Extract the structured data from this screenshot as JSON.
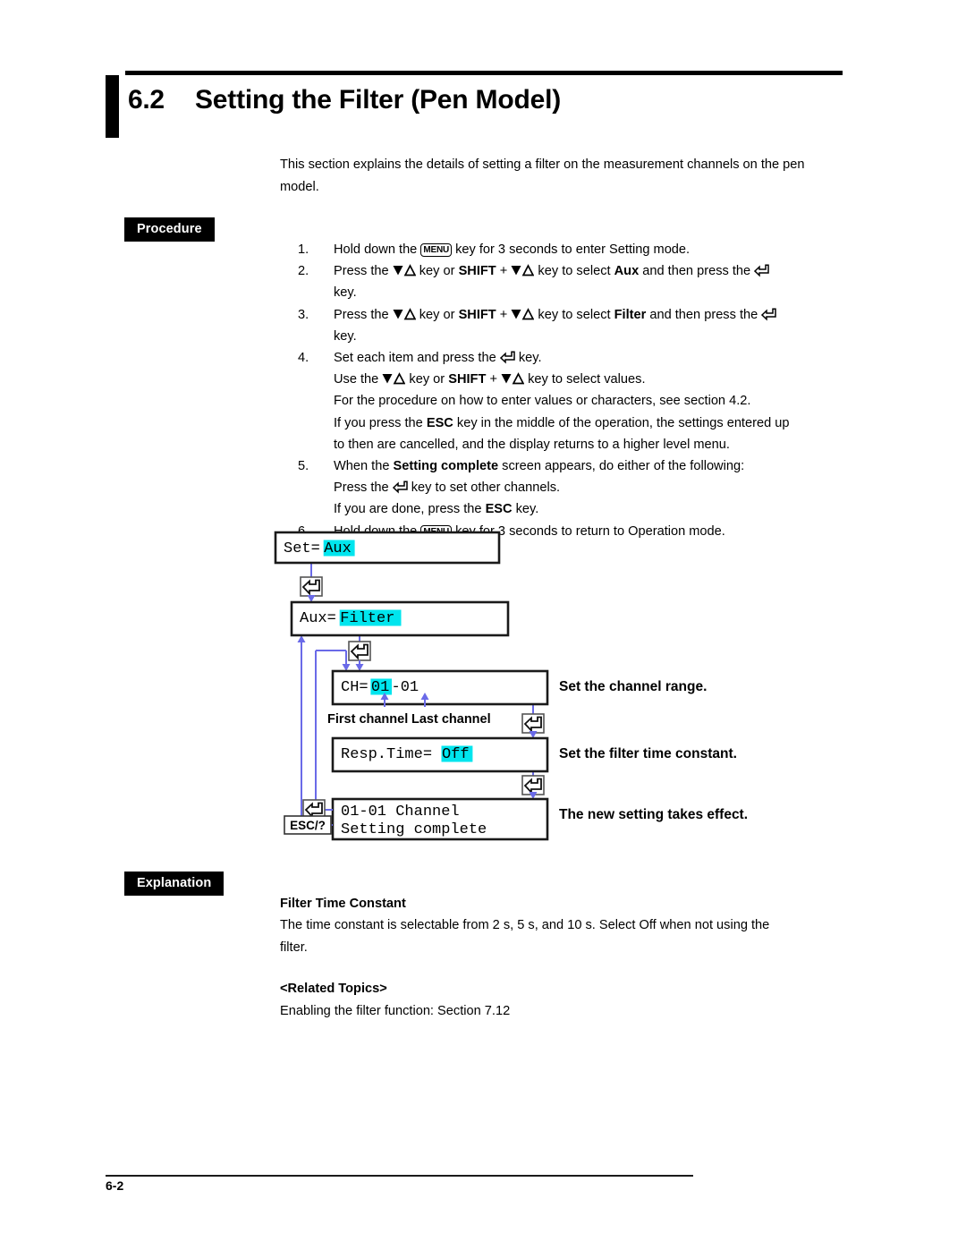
{
  "heading": {
    "number": "6.2",
    "title": "Setting the Filter (Pen Model)"
  },
  "intro": "This section explains the details of setting a filter on the measurement channels on the pen model.",
  "tags": {
    "procedure": "Procedure",
    "explanation": "Explanation"
  },
  "procedure": {
    "steps": [
      {
        "num": "1.",
        "parts": [
          {
            "t": "text",
            "v": "Hold down the "
          },
          {
            "t": "key-menu",
            "v": "MENU"
          },
          {
            "t": "text",
            "v": " key for 3 seconds to enter Setting mode."
          }
        ]
      },
      {
        "num": "2.",
        "parts": [
          {
            "t": "text",
            "v": "Press the "
          },
          {
            "t": "key-ud",
            "v": "down-up-triangle-icon"
          },
          {
            "t": "text",
            "v": " key or "
          },
          {
            "t": "bold",
            "v": "SHIFT"
          },
          {
            "t": "text",
            "v": " + "
          },
          {
            "t": "key-ud",
            "v": "down-up-triangle-icon"
          },
          {
            "t": "text",
            "v": " key to select "
          },
          {
            "t": "bold",
            "v": "Aux"
          },
          {
            "t": "text",
            "v": " and then press the "
          },
          {
            "t": "key-ent",
            "v": "enter-key-icon"
          }
        ],
        "cont": [
          "key."
        ]
      },
      {
        "num": "3.",
        "parts": [
          {
            "t": "text",
            "v": "Press the "
          },
          {
            "t": "key-ud",
            "v": "down-up-triangle-icon"
          },
          {
            "t": "text",
            "v": " key or "
          },
          {
            "t": "bold",
            "v": "SHIFT"
          },
          {
            "t": "text",
            "v": " + "
          },
          {
            "t": "key-ud",
            "v": "down-up-triangle-icon"
          },
          {
            "t": "text",
            "v": " key to select "
          },
          {
            "t": "bold",
            "v": "Filter"
          },
          {
            "t": "text",
            "v": " and then press the "
          },
          {
            "t": "key-ent",
            "v": "enter-key-icon"
          }
        ],
        "cont": [
          "key."
        ]
      },
      {
        "num": "4.",
        "parts": [
          {
            "t": "text",
            "v": "Set each item and press the "
          },
          {
            "t": "key-ent",
            "v": "enter-key-icon"
          },
          {
            "t": "text",
            "v": " key."
          }
        ],
        "sublines": [
          [
            {
              "t": "text",
              "v": "Use the "
            },
            {
              "t": "key-ud",
              "v": "down-up-triangle-icon"
            },
            {
              "t": "text",
              "v": " key or "
            },
            {
              "t": "bold",
              "v": "SHIFT"
            },
            {
              "t": "text",
              "v": " + "
            },
            {
              "t": "key-ud",
              "v": "down-up-triangle-icon"
            },
            {
              "t": "text",
              "v": " key to select values."
            }
          ],
          [
            {
              "t": "text",
              "v": "For the procedure on how to enter values or characters, see section 4.2."
            }
          ],
          [
            {
              "t": "text",
              "v": "If you press the "
            },
            {
              "t": "bold",
              "v": "ESC"
            },
            {
              "t": "text",
              "v": " key in the middle of the operation, the settings entered up"
            }
          ],
          [
            {
              "t": "text",
              "v": "to then are cancelled, and the display returns to a higher level menu."
            }
          ]
        ]
      },
      {
        "num": "5.",
        "parts": [
          {
            "t": "text",
            "v": "When the "
          },
          {
            "t": "bold",
            "v": "Setting complete"
          },
          {
            "t": "text",
            "v": " screen appears, do either of the following:"
          }
        ],
        "sublines": [
          [
            {
              "t": "text",
              "v": "Press the "
            },
            {
              "t": "key-ent",
              "v": "enter-key-icon"
            },
            {
              "t": "text",
              "v": " key to set other channels."
            }
          ],
          [
            {
              "t": "text",
              "v": "If you are done, press the "
            },
            {
              "t": "bold",
              "v": "ESC"
            },
            {
              "t": "text",
              "v": " key."
            }
          ]
        ]
      },
      {
        "num": "6.",
        "parts": [
          {
            "t": "text",
            "v": "Hold down the "
          },
          {
            "t": "key-menu",
            "v": "MENU"
          },
          {
            "t": "text",
            "v": " key for 3 seconds to return to Operation mode."
          }
        ]
      }
    ]
  },
  "flowchart": {
    "highlight_color": "#00E5EE",
    "line_color": "#6A6AE8",
    "screens": [
      {
        "id": "screen-set-aux",
        "prefix": "Set=",
        "value": "Aux",
        "line2": ""
      },
      {
        "id": "screen-aux-filter",
        "prefix": "Aux=",
        "value": "Filter",
        "line2": ""
      },
      {
        "id": "screen-ch-range",
        "prefix": "CH=",
        "value": "01",
        "suffix": "-01",
        "line2": ""
      },
      {
        "id": "screen-resp-time",
        "prefix": "Resp.Time=",
        "value": "Off",
        "line2": ""
      },
      {
        "id": "screen-setting-complete",
        "prefix": "",
        "value": "",
        "line1": "01-01 Channel",
        "line2": "Setting complete"
      }
    ],
    "captions": {
      "first_channel": "First channel",
      "last_channel": "Last channel",
      "channel_range": "Set the channel range.",
      "time_constant": "Set the filter time constant.",
      "takes_effect": "The new setting takes effect."
    },
    "esc_button": "ESC/?"
  },
  "explanation": {
    "heading": "Filter Time Constant",
    "body_line1": "The time constant is selectable from 2 s, 5 s, and 10 s.  Select Off when not using the",
    "body_line2": "filter.",
    "related_heading": "<Related Topics>",
    "related_line": "Enabling the filter function: Section 7.12"
  },
  "footer": {
    "page": "6-2"
  }
}
